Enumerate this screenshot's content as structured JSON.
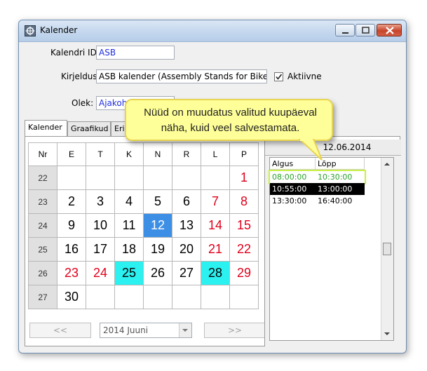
{
  "window": {
    "title": "Kalender"
  },
  "form": {
    "calendar_id_label": "Kalendri ID:",
    "calendar_id_value": "ASB",
    "description_label": "Kirjeldus:",
    "description_value": "ASB kalender (Assembly Stands for Bikes)",
    "active_label": "Aktiivne",
    "active_checked": true,
    "status_label": "Olek:",
    "status_value": "Ajakoha"
  },
  "tabs": [
    "Kalender",
    "Graafikud",
    "Erin"
  ],
  "calendar": {
    "headers": [
      "Nr",
      "E",
      "T",
      "K",
      "N",
      "R",
      "L",
      "P"
    ],
    "weeks": [
      {
        "nr": "22",
        "days": [
          "",
          "",
          "",
          "",
          "",
          "",
          "1"
        ]
      },
      {
        "nr": "23",
        "days": [
          "2",
          "3",
          "4",
          "5",
          "6",
          "7",
          "8"
        ]
      },
      {
        "nr": "24",
        "days": [
          "9",
          "10",
          "11",
          "12",
          "13",
          "14",
          "15"
        ]
      },
      {
        "nr": "25",
        "days": [
          "16",
          "17",
          "18",
          "19",
          "20",
          "21",
          "22"
        ]
      },
      {
        "nr": "26",
        "days": [
          "23",
          "24",
          "25",
          "26",
          "27",
          "28",
          "29"
        ]
      },
      {
        "nr": "27",
        "days": [
          "30",
          "",
          "",
          "",
          "",
          "",
          ""
        ]
      }
    ],
    "selected_day": "12",
    "highlighted_days": [
      "25",
      "28"
    ],
    "red_days": [
      "1",
      "7",
      "8",
      "14",
      "15",
      "21",
      "22",
      "23",
      "24",
      "29"
    ],
    "month_select": "2014 Juuni",
    "prev_label": "<<",
    "next_label": ">>"
  },
  "schedule": {
    "date": "12.06.2014",
    "col_start": "Algus",
    "col_end": "Lõpp",
    "rows": [
      {
        "start": "08:00:00",
        "end": "10:30:00",
        "state": "new"
      },
      {
        "start": "10:55:00",
        "end": "13:00:00",
        "state": "selected"
      },
      {
        "start": "13:30:00",
        "end": "16:40:00",
        "state": "normal"
      }
    ]
  },
  "callout": {
    "line1": "Nüüd on muudatus valitud kuupäeval",
    "line2": "näha, kuid veel salvestamata."
  },
  "colors": {
    "selected_day": "#3d8fe6",
    "highlight_day": "#2bf1f0",
    "holiday_text": "#e0001b",
    "callout_bg": "#ffff99",
    "new_row_text": "#2aa02a",
    "new_row_border": "#c9f04a"
  }
}
